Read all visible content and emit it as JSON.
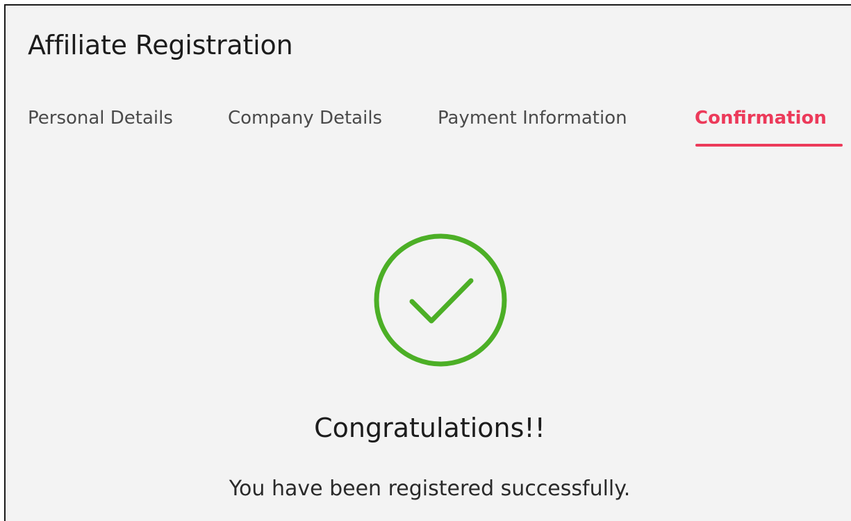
{
  "page": {
    "title": "Affiliate Registration"
  },
  "tabs": [
    {
      "label": "Personal Details",
      "active": false
    },
    {
      "label": "Company Details",
      "active": false
    },
    {
      "label": "Payment Information",
      "active": false
    },
    {
      "label": "Confirmation",
      "active": true
    }
  ],
  "confirmation": {
    "icon": "check-circle-icon",
    "headline": "Congratulations!!",
    "message": "You have been registered successfully."
  },
  "colors": {
    "accent": "#ec3a5a",
    "success": "#4caf26"
  }
}
